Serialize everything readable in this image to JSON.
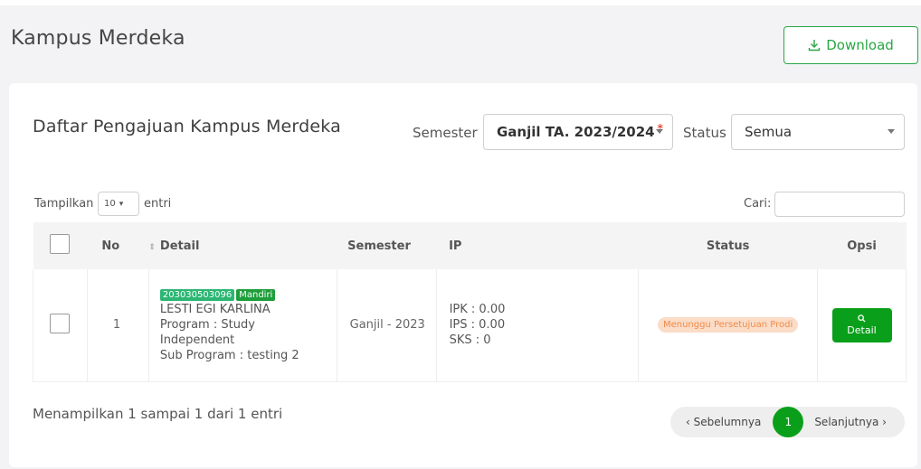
{
  "page": {
    "title": "Kampus Merdeka",
    "download_label": "Download"
  },
  "card": {
    "title": "Daftar Pengajuan Kampus Merdeka",
    "semester_label": "Semester",
    "semester_value": "Ganjil TA. 2023/2024",
    "required_mark": "*",
    "status_label": "Status",
    "status_value": "Semua"
  },
  "table_controls": {
    "show_label": "Tampilkan",
    "entries_value": "10",
    "entries_suffix": "entri",
    "search_label": "Cari:",
    "search_value": ""
  },
  "table": {
    "headers": [
      "No",
      "Detail",
      "Semester",
      "IP",
      "Status",
      "Opsi"
    ],
    "rows": [
      {
        "no": "1",
        "nim": "203030503096",
        "type_badge": "Mandiri",
        "name": "LESTI EGI KARLINA",
        "program_line1": "Program : Study",
        "program_line2": "Independent",
        "sub_program": "Sub Program : testing 2",
        "semester": "Ganjil - 2023",
        "ipk": "IPK : 0.00",
        "ips": "IPS : 0.00",
        "sks": "SKS : 0",
        "status": "Menunggu Persetujuan Prodi",
        "action_label": "Detail"
      }
    ]
  },
  "footer": {
    "info": "Menampilkan 1 sampai 1 dari 1 entri",
    "prev_label": "‹ Sebelumnya",
    "current_page": "1",
    "next_label": "Selanjutnya ›"
  },
  "colors": {
    "primary_green": "#0a9f1a",
    "outline_green": "#28a745",
    "status_bg": "#fbdcc7",
    "status_text": "#f08c4a"
  }
}
